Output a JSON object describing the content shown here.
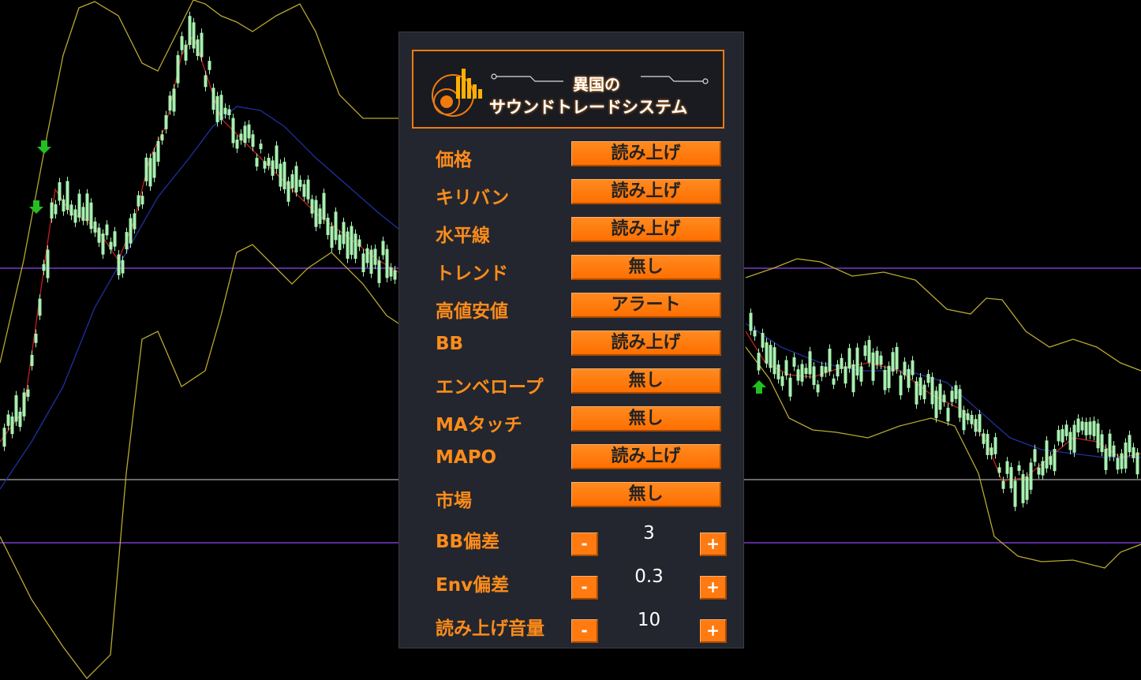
{
  "logo": {
    "line1": "異国の",
    "line2": "サウンドトレードシステム"
  },
  "settings": [
    {
      "label": "価格",
      "value": "読み上げ"
    },
    {
      "label": "キリバン",
      "value": "読み上げ"
    },
    {
      "label": "水平線",
      "value": "読み上げ"
    },
    {
      "label": "トレンド",
      "value": "無し"
    },
    {
      "label": "高値安値",
      "value": "アラート"
    },
    {
      "label": "BB",
      "value": "読み上げ"
    },
    {
      "label": "エンベロープ",
      "value": "無し"
    },
    {
      "label": "MAタッチ",
      "value": "無し"
    },
    {
      "label": "MAPO",
      "value": "読み上げ"
    },
    {
      "label": "市場",
      "value": "無し"
    }
  ],
  "steppers": [
    {
      "label": "BB偏差",
      "value": "3",
      "minus": "-",
      "plus": "+"
    },
    {
      "label": "Env偏差",
      "value": "0.3",
      "minus": "-",
      "plus": "+"
    },
    {
      "label": "読み上げ音量",
      "value": "10",
      "minus": "-",
      "plus": "+"
    }
  ],
  "colors": {
    "accent": "#ff7a10",
    "label": "#ff8c1a",
    "panel_bg": "#23262e",
    "candle": "#a8f0b0",
    "band": "#b8a830",
    "ma_red": "#c02020",
    "ma_blue": "#2030a0",
    "hline_purple": "#5a2d9a",
    "hline_gray": "#6a6a6a",
    "signal_arrow": "#22c022"
  },
  "icons": {
    "logo": "speaker-equalizer-icon",
    "sell_arrow": "down-arrow-icon",
    "buy_arrow": "up-arrow-icon"
  }
}
